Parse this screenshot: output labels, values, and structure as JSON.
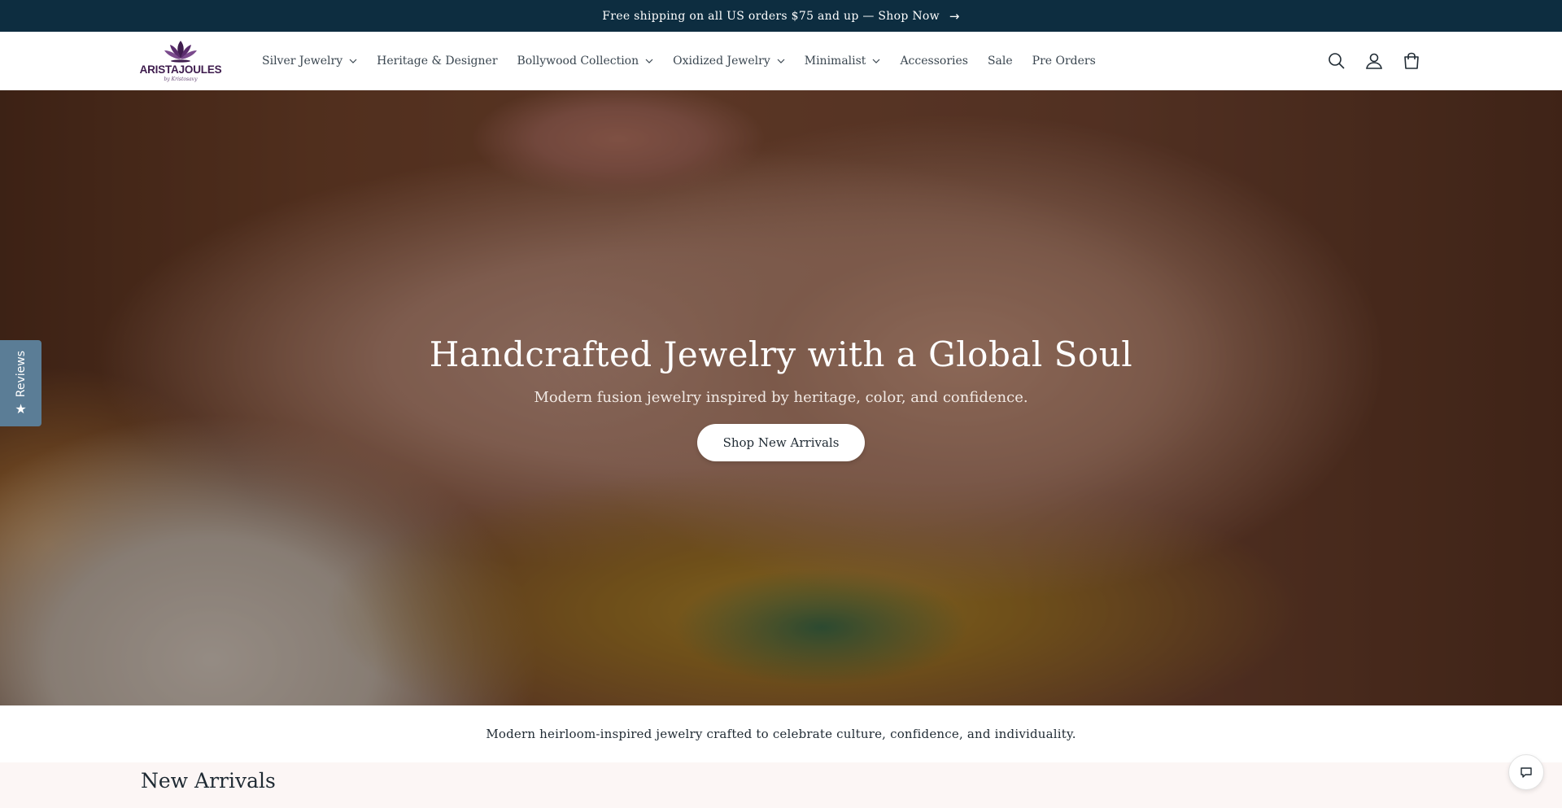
{
  "announcement": {
    "text": "Free shipping on all US orders $75 and up — Shop Now",
    "arrow": "→"
  },
  "logo": {
    "name": "ARISTAJOULES",
    "sub": "by Kristosavy",
    "color": "#3f1d4e"
  },
  "nav": {
    "items": [
      {
        "label": "Silver Jewelry",
        "dropdown": true
      },
      {
        "label": "Heritage & Designer",
        "dropdown": false
      },
      {
        "label": "Bollywood Collection",
        "dropdown": true
      },
      {
        "label": "Oxidized Jewelry",
        "dropdown": true
      },
      {
        "label": "Minimalist",
        "dropdown": true
      },
      {
        "label": "Accessories",
        "dropdown": false
      },
      {
        "label": "Sale",
        "dropdown": false
      },
      {
        "label": "Pre Orders",
        "dropdown": false
      }
    ]
  },
  "header_icons": [
    "search-icon",
    "account-icon",
    "cart-icon"
  ],
  "hero": {
    "title": "Handcrafted Jewelry with a Global Soul",
    "subtitle": "Modern fusion jewelry inspired by heritage, color, and confidence.",
    "button": "Shop New Arrivals"
  },
  "reviews_tab": {
    "label": "Reviews",
    "icon": "star-icon"
  },
  "tagline": "Modern heirloom-inspired jewelry crafted to celebrate culture, confidence, and individuality.",
  "new_arrivals": {
    "title": "New Arrivals"
  },
  "chat": {
    "icon": "chat-icon"
  },
  "colors": {
    "announcement_bg": "#0d2d40",
    "reviews_tab_bg": "#5b7d96",
    "section_bg": "#fcf6f5"
  }
}
